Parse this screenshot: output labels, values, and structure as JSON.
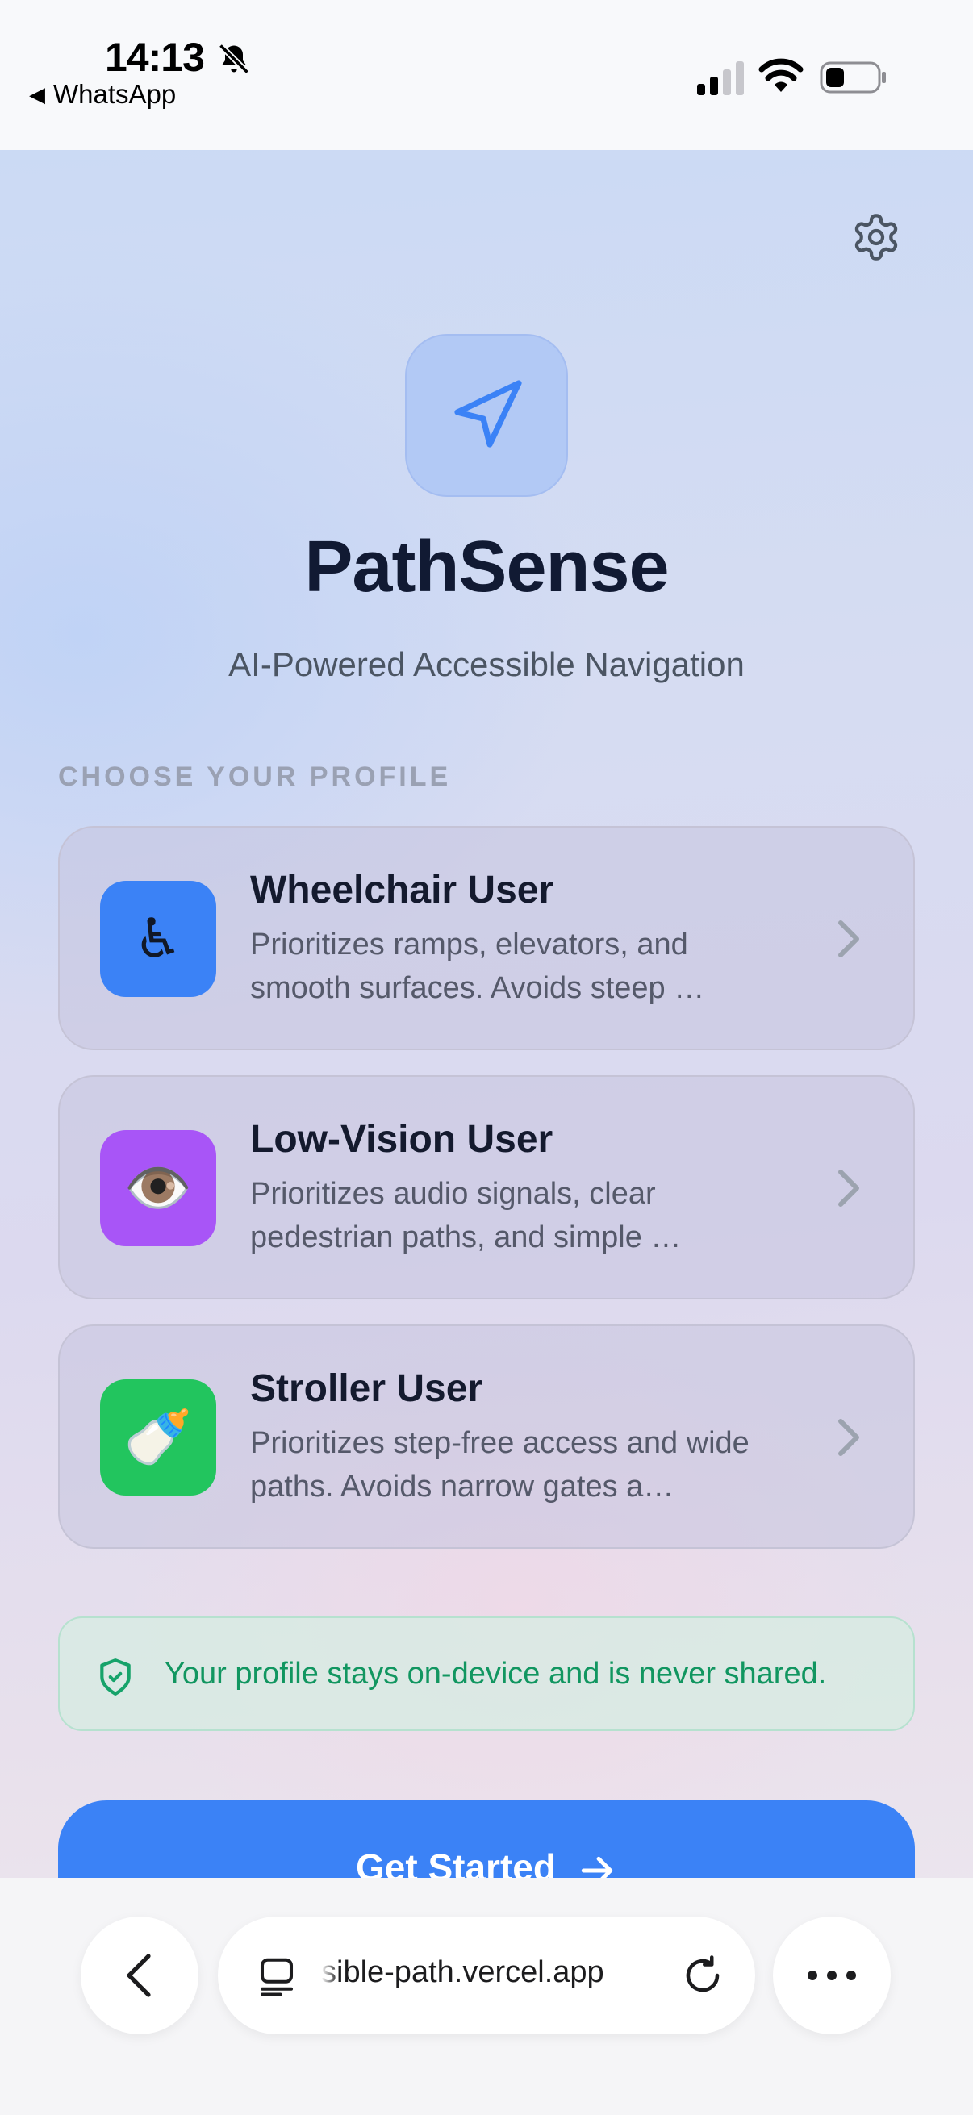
{
  "status_bar": {
    "time": "14:13",
    "back_app": "WhatsApp",
    "icons": [
      "bell-slash-icon",
      "cellular-signal-icon",
      "wifi-icon",
      "battery-icon"
    ]
  },
  "app": {
    "title": "PathSense",
    "subtitle": "AI-Powered Accessible Navigation",
    "logo_icon": "navigation-arrow-icon",
    "settings_icon": "gear-icon"
  },
  "profiles": {
    "section_label": "CHOOSE YOUR PROFILE",
    "items": [
      {
        "title": "Wheelchair User",
        "description": "Prioritizes ramps, elevators, and smooth surfaces. Avoids steep …",
        "emoji": "♿",
        "icon_color": "#3b82f6"
      },
      {
        "title": "Low-Vision User",
        "description": "Prioritizes audio signals, clear pedestrian paths, and simple …",
        "emoji": "👁️",
        "icon_color": "#a855f7"
      },
      {
        "title": "Stroller User",
        "description": "Prioritizes step-free access and wide paths. Avoids narrow gates a…",
        "emoji": "🍼",
        "icon_color": "#22c55e"
      }
    ]
  },
  "privacy": {
    "text": "Your profile stays on-device and is never shared.",
    "icon": "shield-check-icon"
  },
  "cta": {
    "label": "Get Started"
  },
  "browser": {
    "url_text": "sible-path.vercel.app"
  },
  "colors": {
    "accent": "#3b82f6",
    "privacy_green": "#119660"
  }
}
